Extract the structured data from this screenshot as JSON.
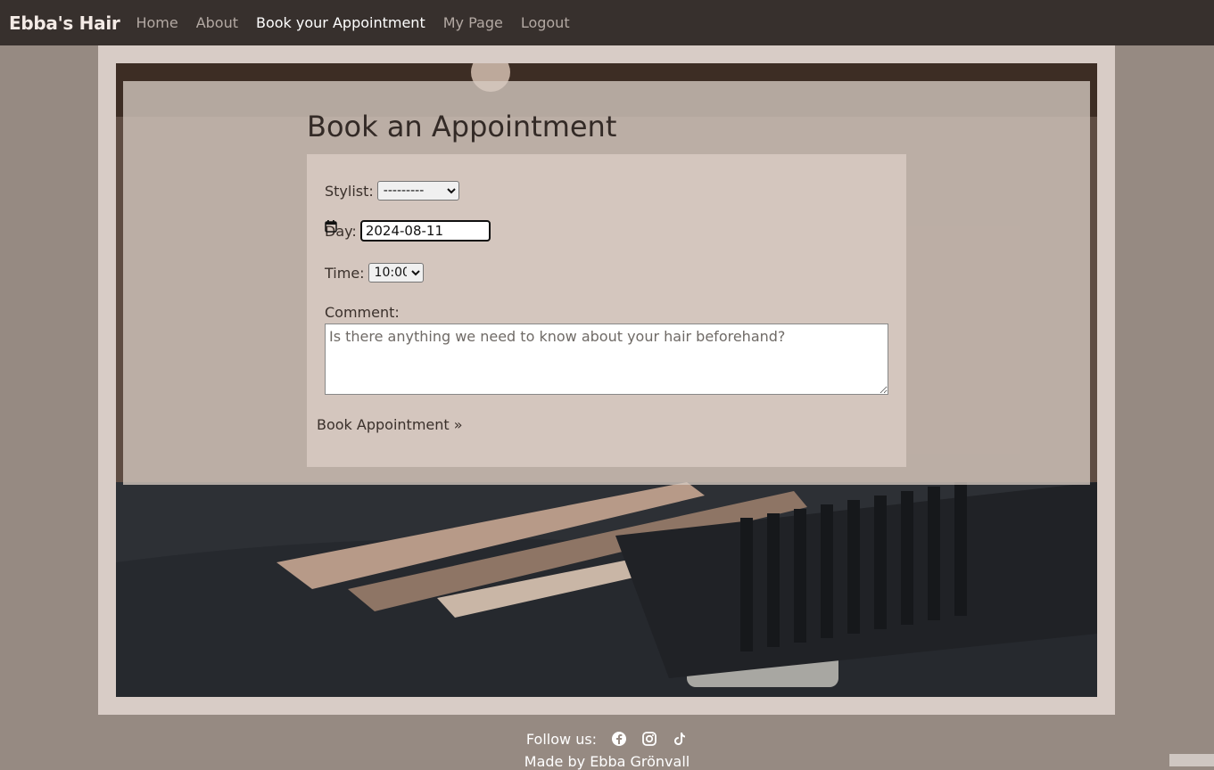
{
  "navbar": {
    "brand": "Ebba's Hair",
    "links": [
      {
        "label": "Home"
      },
      {
        "label": "About"
      },
      {
        "label": "Book your Appointment"
      },
      {
        "label": "My Page"
      },
      {
        "label": "Logout"
      }
    ]
  },
  "form": {
    "title": "Book an Appointment",
    "stylist_label": "Stylist:",
    "stylist_value": "---------",
    "day_label": "Day:",
    "day_value": "2024-08-11",
    "time_label": "Time:",
    "time_value": "10:00",
    "comment_label": "Comment:",
    "comment_placeholder": "Is there anything we need to know about your hair beforehand?",
    "submit_label": "Book Appointment »"
  },
  "footer": {
    "follow_label": "Follow us:",
    "social_icons": [
      "facebook-icon",
      "instagram-icon",
      "tiktok-icon"
    ],
    "made_by": "Made by Ebba Grönvall"
  },
  "colors": {
    "navbar": "#37302d",
    "page_background": "#968a82",
    "frame": "#d8ccc6",
    "card": "#d4c6be"
  }
}
